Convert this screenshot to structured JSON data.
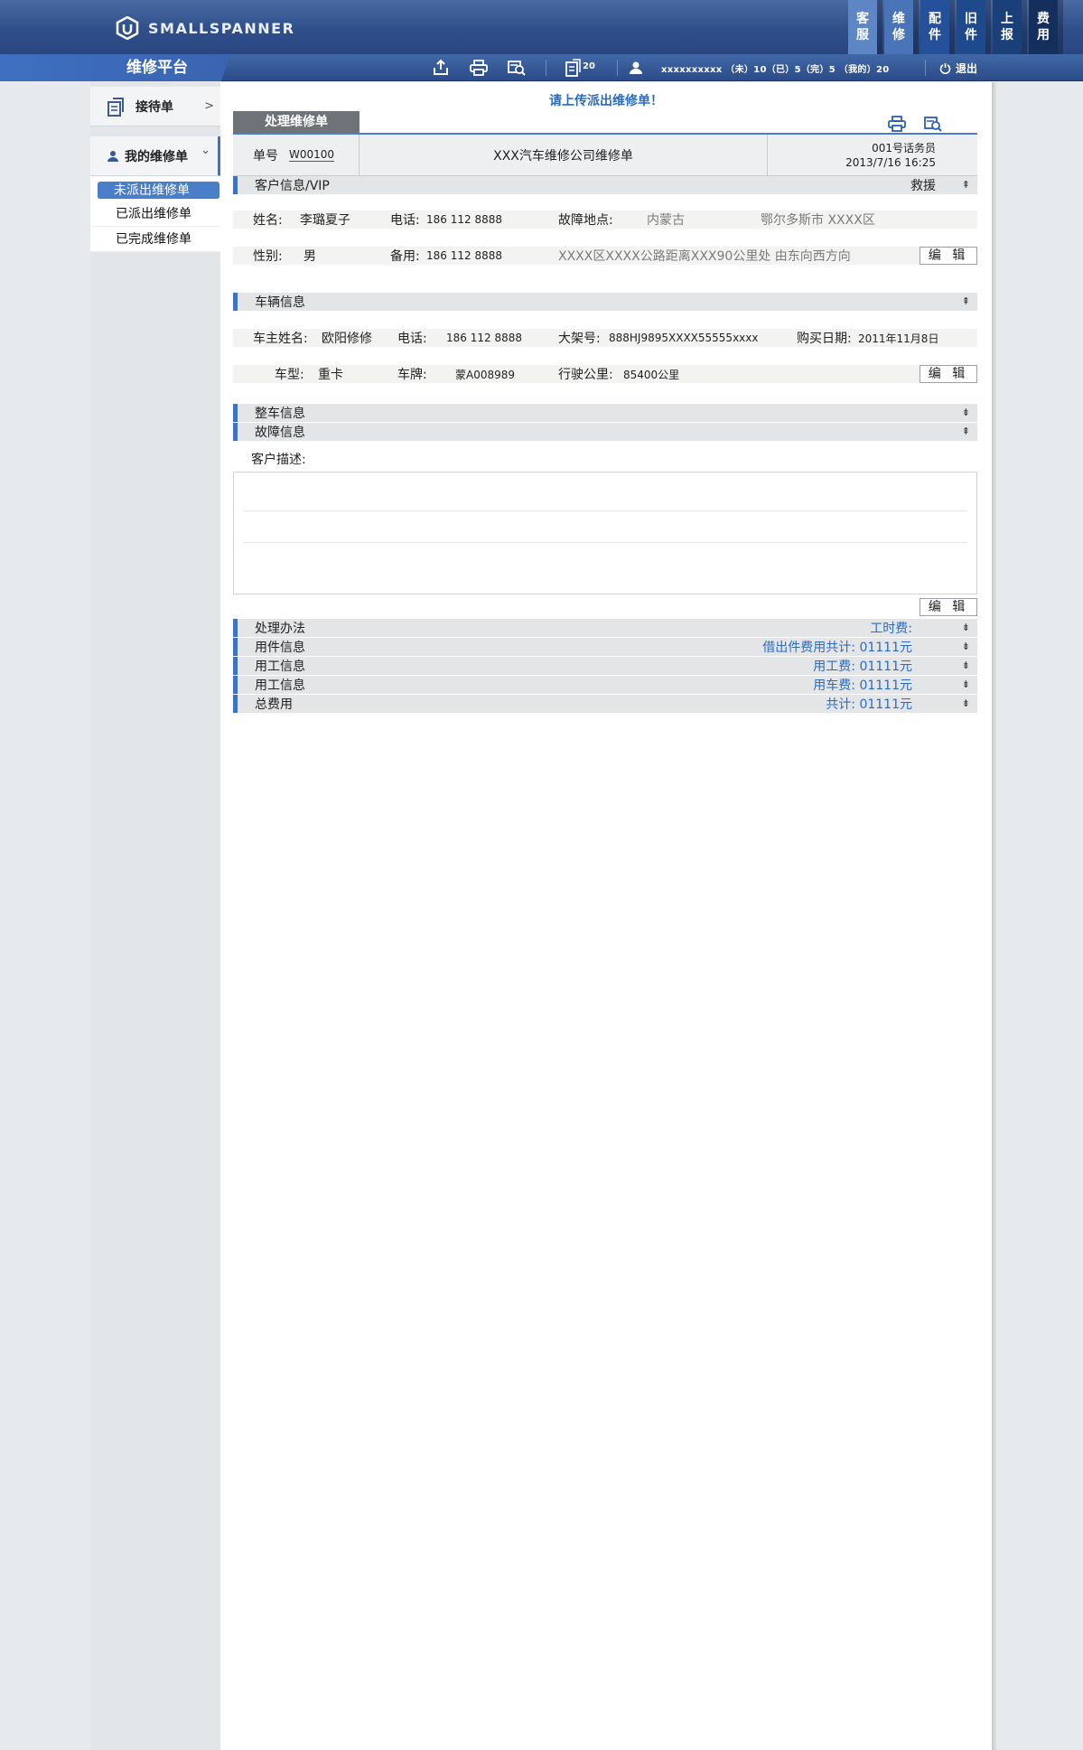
{
  "header": {
    "brand": "SMALLSPANNER",
    "tabs": [
      {
        "label": "客服"
      },
      {
        "label": "维修"
      },
      {
        "label": "配件"
      },
      {
        "label": "旧件"
      },
      {
        "label": "上报"
      },
      {
        "label": "费用"
      }
    ]
  },
  "toolbar": {
    "platform_title": "维修平台",
    "doc_count": "20",
    "user_info": "xxxxxxxxxx （未）10（已）5（完）5 （我的）20",
    "logout_label": "退出"
  },
  "sidebar": {
    "received_label": "接待单",
    "received_arrow": ">",
    "mine_label": "我的维修单",
    "mine_arrow": "⌄",
    "sub_items": [
      {
        "label": "未派出维修单"
      },
      {
        "label": "已派出维修单"
      },
      {
        "label": "已完成维修单"
      }
    ]
  },
  "main": {
    "notice": "请上传派出维修单！",
    "form_title": "处理维修单",
    "order": {
      "no_label": "单号",
      "no_value": "W00100",
      "company": "XXX汽车维修公司维修单",
      "operator": "001号话务员",
      "datetime": "2013/7/16   16:25"
    },
    "customer": {
      "section_label": "客户信息/VIP",
      "rescue": "救援",
      "name_label": "姓名:",
      "name_value": "李璐夏子",
      "phone_label": "电话:",
      "phone_value": "186 112 8888",
      "location_label": "故障地点:",
      "location_value": "内蒙古",
      "location_city": "鄂尔多斯市 XXXX区",
      "gender_label": "性别:",
      "gender_value": "男",
      "backup_label": "备用:",
      "backup_value": "186 112 8888",
      "address_detail": "XXXX区XXXX公路距离XXX90公里处 由东向西方向"
    },
    "vehicle": {
      "section_label": "车辆信息",
      "owner_label": "车主姓名:",
      "owner_value": "欧阳修修",
      "phone_label": "电话:",
      "phone_value": "186 112 8888",
      "frame_label": "大架号:",
      "frame_value": "888HJ9895XXXX55555xxxx",
      "purchase_label": "购买日期:",
      "purchase_value": "2011年11月8日",
      "type_label": "车型:",
      "type_value": "重卡",
      "plate_label": "车牌:",
      "plate_value": "蒙A008989",
      "mileage_label": "行驶公里:",
      "mileage_value": "85400公里"
    },
    "whole_vehicle_label": "整车信息",
    "fault": {
      "section_label": "故障信息",
      "desc_label": "客户描述:"
    },
    "edit_label": "编 辑",
    "bottom_sections": [
      {
        "label": "处理办法",
        "right": "工时费:"
      },
      {
        "label": "用件信息",
        "right": "借出件费用共计:  01111元"
      },
      {
        "label": "用工信息",
        "right": "用工费:  01111元"
      },
      {
        "label": "用工信息",
        "right": "用车费:  01111元"
      },
      {
        "label": "总费用",
        "right": "共计:  01111元"
      }
    ],
    "chevron_up": "⇞",
    "chevron_down": "⇟"
  },
  "colors": {
    "header_bg": "#2f4f8a",
    "accent": "#3f72c2",
    "link_blue": "#2b6cc0",
    "form_title_bg": "#6f7378"
  }
}
